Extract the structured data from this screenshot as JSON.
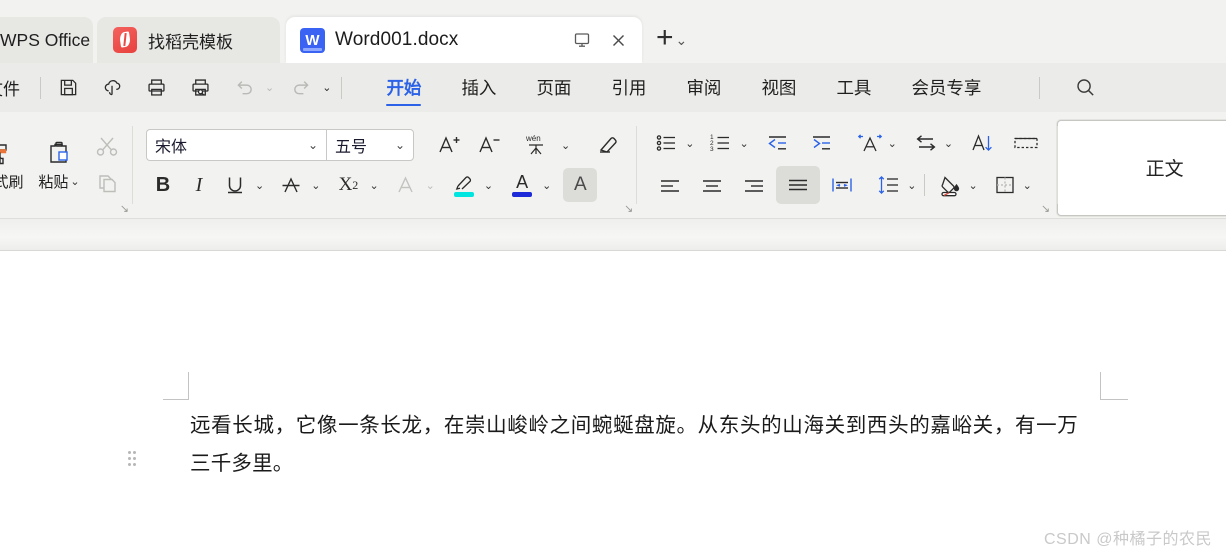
{
  "tabbar": {
    "wps_tab": "WPS Office",
    "docer_tab": "找稻壳模板",
    "active_tab": "Word001.docx",
    "new_tab_label": "+",
    "new_tab_caret": "⌄"
  },
  "menubar": {
    "file": "文件",
    "items": [
      {
        "label": "开始",
        "active": true
      },
      {
        "label": "插入",
        "active": false
      },
      {
        "label": "页面",
        "active": false
      },
      {
        "label": "引用",
        "active": false
      },
      {
        "label": "审阅",
        "active": false
      },
      {
        "label": "视图",
        "active": false
      },
      {
        "label": "工具",
        "active": false
      },
      {
        "label": "会员专享",
        "active": false
      }
    ],
    "quick_access": [
      {
        "name": "save-icon",
        "disabled": false
      },
      {
        "name": "cloud-sync-icon",
        "disabled": false
      },
      {
        "name": "print-icon",
        "disabled": false
      },
      {
        "name": "print-preview-icon",
        "disabled": false
      },
      {
        "name": "undo-icon",
        "disabled": true
      },
      {
        "name": "redo-icon",
        "disabled": true
      },
      {
        "name": "customize-caret-icon",
        "disabled": false
      }
    ],
    "search_icon": "search-icon"
  },
  "ribbon": {
    "clipboard": {
      "format_painter_label": "格式刷",
      "paste_label": "粘贴",
      "cut_icon": "scissors-icon",
      "copy_icon": "copy-icon"
    },
    "font": {
      "font_name": "宋体",
      "font_size": "五号",
      "grow_font": "A+",
      "shrink_font": "A−",
      "pinyin_label": "wén",
      "clear_format_icon": "eraser-icon",
      "bold": "B",
      "italic": "I",
      "underline": "U",
      "strikethrough": "A",
      "superscript": "X²",
      "text_effect": "A",
      "highlight_color": "#00e5e0",
      "font_color": "#1c2ad8",
      "char_shading": "A",
      "char_shading_selected": true
    },
    "paragraph": {
      "bullets_icon": "bullet-list-icon",
      "numbering_icon": "numbered-list-icon",
      "decrease_indent_icon": "decrease-indent-icon",
      "increase_indent_icon": "increase-indent-icon",
      "char_scaling_icon": "character-scaling-icon",
      "text_direction_icon": "text-direction-icon",
      "sort_icon": "sort-icon",
      "show_marks_icon": "show-formatting-marks-icon",
      "align_left_icon": "align-left-icon",
      "align_center_icon": "align-center-icon",
      "align_right_icon": "align-right-icon",
      "justify_icon": "justify-icon",
      "justify_selected": true,
      "distributed_icon": "distributed-align-icon",
      "line_spacing_icon": "line-spacing-icon",
      "shading_icon": "shading-icon",
      "borders_icon": "borders-icon"
    },
    "styles": {
      "body_style": "正文"
    }
  },
  "document": {
    "paragraph_text": "远看长城，它像一条长龙，在崇山峻岭之间蜿蜒盘旋。从东头的山海关到西头的嘉峪关，有一万三千多里。"
  },
  "watermark": {
    "text": "CSDN @种橘子的农民"
  }
}
